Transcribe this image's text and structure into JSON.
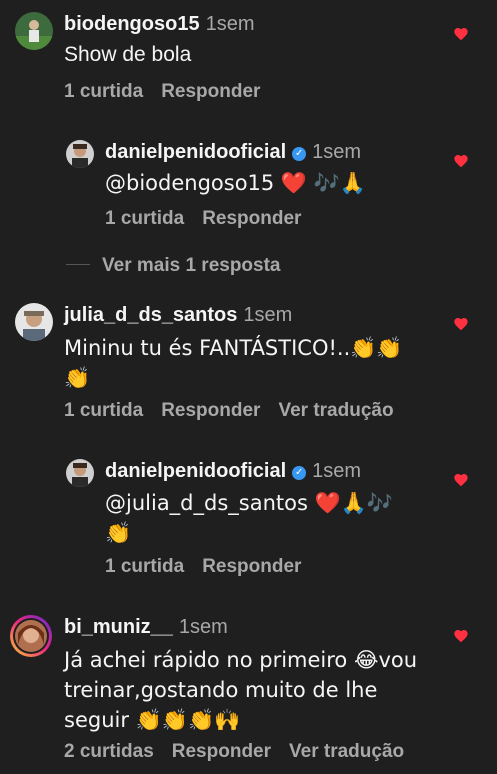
{
  "comments": [
    {
      "user": "biodengoso15",
      "time": "1sem",
      "text": "Show de bola",
      "likes": "1 curtida",
      "reply": "Responder"
    },
    {
      "user": "danielpenidooficial",
      "time": "1sem",
      "text": "@biodengoso15 ❤️ 🎶🙏",
      "likes": "1 curtida",
      "reply": "Responder"
    },
    {
      "user": "julia_d_ds_santos",
      "time": "1sem",
      "text": "Mininu tu és FANTÁSTICO!..👏👏 👏",
      "likes": "1 curtida",
      "reply": "Responder",
      "translate": "Ver tradução"
    },
    {
      "user": "danielpenidooficial",
      "time": "1sem",
      "text": "@julia_d_ds_santos ❤️🙏🎶 👏",
      "likes": "1 curtida",
      "reply": "Responder"
    },
    {
      "user": "bi_muniz__",
      "time": "1sem",
      "text": "Já achei rápido no primeiro 😂vou treinar,gostando muito de lhe seguir 👏👏👏🙌",
      "likes": "2 curtidas",
      "reply": "Responder",
      "translate": "Ver tradução"
    }
  ],
  "view_more": "Ver mais 1 resposta",
  "colors": {
    "background": "#1f1f1f",
    "heart": "#ff3040",
    "verified": "#3897f0",
    "muted": "#a8a8a8"
  },
  "icons": {
    "heart": "heart-icon",
    "verified": "verified-badge-icon"
  }
}
